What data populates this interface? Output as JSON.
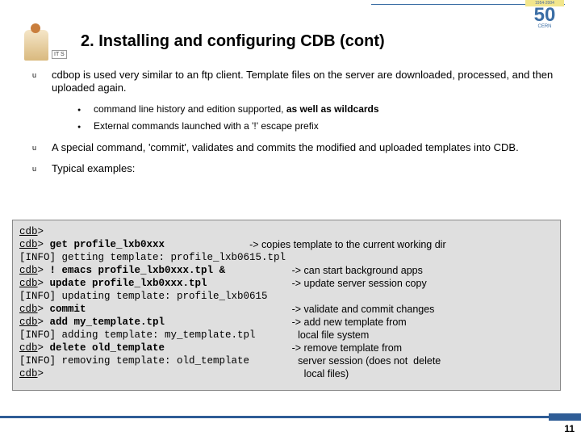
{
  "logo_left_label": "IT S",
  "logo_right": {
    "banner": "1954-2004",
    "fifty": "5",
    "zero": "0",
    "cern": "CERN"
  },
  "title": "2. Installing and configuring CDB (cont)",
  "bullets": [
    {
      "pre": "cdbop",
      "text": " is used very similar to an ftp client. Template files on the server are downloaded, processed, and then uploaded again.",
      "subs": [
        {
          "pre": "command line history and edition supported, ",
          "bold": "as well as wildcards"
        },
        {
          "text": "External commands launched with a '!' escape prefix"
        }
      ]
    },
    {
      "text": "A special command, 'commit', validates and commits the modified and uploaded templates into CDB."
    },
    {
      "text": "Typical examples:"
    }
  ],
  "code": {
    "l1_prompt": "cdb",
    "l1_gt": ">",
    "l2_prompt": "cdb",
    "l2_gt": "> ",
    "l2_cmd": "get profile_lxb0xxx",
    "l2_spaces": "              ",
    "l2_note": "-> copies template to the current working dir",
    "l3": "[INFO] getting template: profile_lxb0615.tpl",
    "l4_prompt": "cdb",
    "l4_gt": "> ",
    "l4_cmd": "! emacs profile_lxb0xxx.tpl &",
    "l4_spaces": "           ",
    "l4_note": "-> can start background apps",
    "l5_prompt": "cdb",
    "l5_gt": "> ",
    "l5_cmd": "update profile_lxb0xxx.tpl",
    "l5_spaces": "              ",
    "l5_note": "-> update server session copy",
    "l6": "[INFO] updating template: profile_lxb0615",
    "l7_prompt": "cdb",
    "l7_gt": "> ",
    "l7_cmd": "commit",
    "l7_spaces": "                                  ",
    "l7_note": "-> validate and commit changes",
    "l8_prompt": "cdb",
    "l8_gt": "> ",
    "l8_cmd": "add my_template.tpl",
    "l8_spaces": "                     ",
    "l8_note": "-> add new template from",
    "l9": "[INFO] adding template: my_template.tpl",
    "l9_spaces": "       ",
    "l9_note": "local file system",
    "l10_prompt": "cdb",
    "l10_gt": "> ",
    "l10_cmd": "delete old_template",
    "l10_spaces": "                     ",
    "l10_note": "-> remove template from",
    "l11": "[INFO] removing template: old_template",
    "l11_spaces": "        ",
    "l11_note": "server session (does not  delete",
    "l12_prompt": "cdb",
    "l12_gt": ">",
    "l12_spaces": "                                           ",
    "l12_note": "local files)"
  },
  "page_number": "11"
}
